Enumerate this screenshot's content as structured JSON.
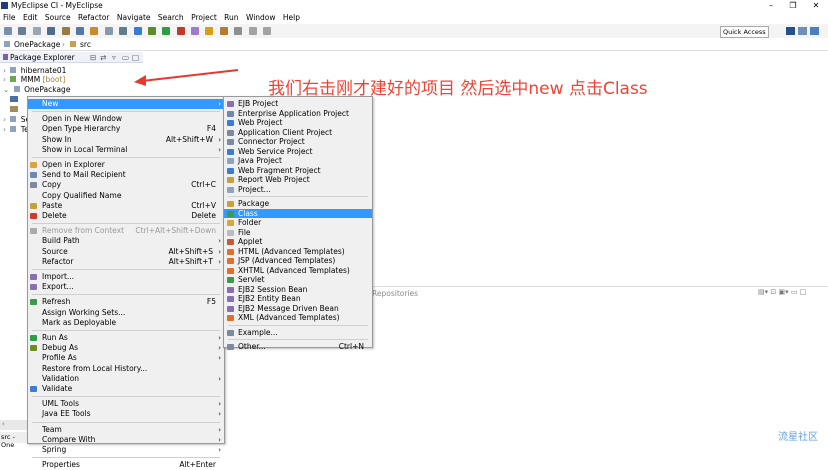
{
  "window": {
    "title": "MyEclipse CI - MyEclipse",
    "minimize": "–",
    "maximize": "❐",
    "close": "✕"
  },
  "menubar": [
    "File",
    "Edit",
    "Source",
    "Refactor",
    "Navigate",
    "Search",
    "Project",
    "Run",
    "Window",
    "Help"
  ],
  "quick_access": "Quick Access",
  "breadcrumb": {
    "project": "OnePackage",
    "folder": "src"
  },
  "package_explorer": {
    "title": "Package Explorer",
    "items": [
      {
        "label": "hibernate01"
      },
      {
        "label": "MMM",
        "tag": "[boot]"
      },
      {
        "label": "OnePackage"
      },
      {
        "label": "Se"
      },
      {
        "label": "Te"
      }
    ]
  },
  "caption": "我们右击刚才建好的项目 然后选中new 点击Class",
  "repositories_tab": "Repositories",
  "watermark": "流星社区",
  "status_left": "src - One",
  "context_menu": [
    {
      "label": "New",
      "arrow": true,
      "highlight": true
    },
    {
      "sep": true
    },
    {
      "label": "Open in New Window"
    },
    {
      "label": "Open Type Hierarchy",
      "shortcut": "F4"
    },
    {
      "label": "Show In",
      "shortcut": "Alt+Shift+W",
      "arrow": true
    },
    {
      "label": "Show in Local Terminal",
      "arrow": true
    },
    {
      "sep": true
    },
    {
      "label": "Open in Explorer"
    },
    {
      "label": "Send to Mail Recipient"
    },
    {
      "label": "Copy",
      "shortcut": "Ctrl+C"
    },
    {
      "label": "Copy Qualified Name"
    },
    {
      "label": "Paste",
      "shortcut": "Ctrl+V"
    },
    {
      "label": "Delete",
      "shortcut": "Delete"
    },
    {
      "sep": true
    },
    {
      "label": "Remove from Context",
      "shortcut": "Ctrl+Alt+Shift+Down",
      "disabled": true
    },
    {
      "label": "Build Path",
      "arrow": true
    },
    {
      "label": "Source",
      "shortcut": "Alt+Shift+S",
      "arrow": true
    },
    {
      "label": "Refactor",
      "shortcut": "Alt+Shift+T",
      "arrow": true
    },
    {
      "sep": true
    },
    {
      "label": "Import..."
    },
    {
      "label": "Export..."
    },
    {
      "sep": true
    },
    {
      "label": "Refresh",
      "shortcut": "F5"
    },
    {
      "label": "Assign Working Sets..."
    },
    {
      "label": "Mark as Deployable"
    },
    {
      "sep": true
    },
    {
      "label": "Run As",
      "arrow": true
    },
    {
      "label": "Debug As",
      "arrow": true
    },
    {
      "label": "Profile As",
      "arrow": true
    },
    {
      "label": "Restore from Local History..."
    },
    {
      "label": "Validation",
      "arrow": true
    },
    {
      "label": "Validate"
    },
    {
      "sep": true
    },
    {
      "label": "UML Tools",
      "arrow": true
    },
    {
      "label": "Java EE Tools",
      "arrow": true
    },
    {
      "sep": true
    },
    {
      "label": "Team",
      "arrow": true
    },
    {
      "label": "Compare With",
      "arrow": true
    },
    {
      "label": "Spring",
      "arrow": true
    },
    {
      "sep": true
    },
    {
      "label": "Properties",
      "shortcut": "Alt+Enter"
    }
  ],
  "submenu": [
    {
      "label": "EJB Project"
    },
    {
      "label": "Enterprise Application Project"
    },
    {
      "label": "Web Project"
    },
    {
      "label": "Application Client Project"
    },
    {
      "label": "Connector Project"
    },
    {
      "label": "Web Service Project"
    },
    {
      "label": "Java Project"
    },
    {
      "label": "Web Fragment Project"
    },
    {
      "label": "Report Web Project"
    },
    {
      "label": "Project..."
    },
    {
      "sep": true
    },
    {
      "label": "Package"
    },
    {
      "label": "Class",
      "highlight": true
    },
    {
      "label": "Folder"
    },
    {
      "label": "File"
    },
    {
      "label": "Applet"
    },
    {
      "label": "HTML (Advanced Templates)"
    },
    {
      "label": "JSP (Advanced Templates)"
    },
    {
      "label": "XHTML (Advanced Templates)"
    },
    {
      "label": "Servlet"
    },
    {
      "label": "EJB2 Session Bean"
    },
    {
      "label": "EJB2 Entity Bean"
    },
    {
      "label": "EJB2 Message Driven Bean"
    },
    {
      "label": "XML (Advanced Templates)"
    },
    {
      "sep": true
    },
    {
      "label": "Example..."
    },
    {
      "sep": true
    },
    {
      "label": "Other...",
      "shortcut": "Ctrl+N"
    }
  ],
  "colors": {
    "highlight": "#3399ff",
    "caption": "#ef4435",
    "arrow": "#e53a2f"
  }
}
